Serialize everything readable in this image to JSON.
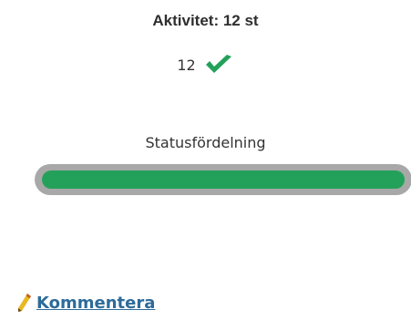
{
  "activity": {
    "title": "Aktivitet: 12 st",
    "count": "12",
    "count_icon": "checkmark-icon"
  },
  "status": {
    "heading": "Statusfördelning",
    "segments": [
      {
        "status": "done",
        "fraction": 1.0,
        "color": "#23a15b"
      }
    ],
    "track_color": "#a8a8a8"
  },
  "comment": {
    "label": "Kommentera",
    "icon": "pencil-icon",
    "color": "#2d6b9a"
  }
}
